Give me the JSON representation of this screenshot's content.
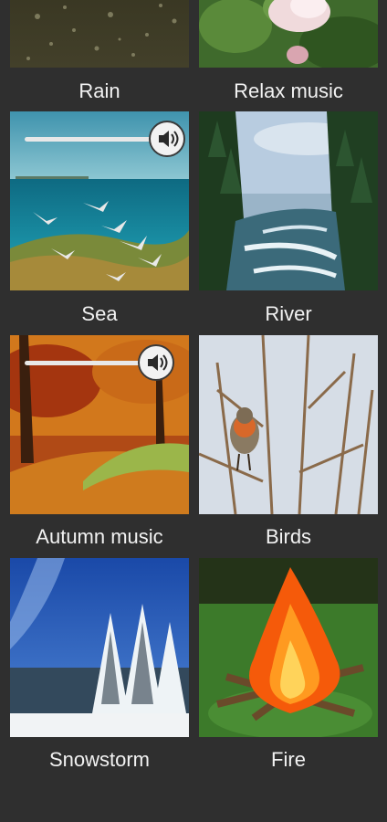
{
  "sounds": [
    {
      "label": "Rain"
    },
    {
      "label": "Relax music"
    },
    {
      "label": "Sea",
      "volume_fraction": 0.95
    },
    {
      "label": "River"
    },
    {
      "label": "Autumn music",
      "volume_fraction": 0.85
    },
    {
      "label": "Birds"
    },
    {
      "label": "Snowstorm"
    },
    {
      "label": "Fire"
    }
  ],
  "icons": {
    "volume": "speaker-volume-icon"
  },
  "colors": {
    "background": "#2f2f2f",
    "label": "#f2f2f2"
  }
}
